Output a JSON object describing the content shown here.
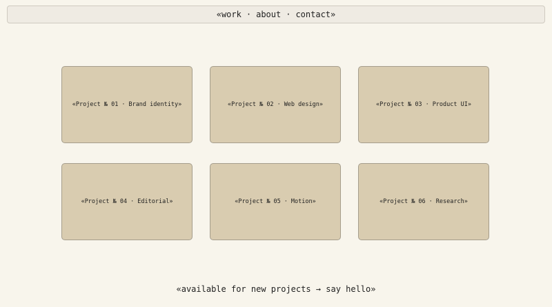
{
  "nav": {
    "open": "«",
    "items": [
      "work",
      "about",
      "contact"
    ],
    "separator": "·",
    "close": "»"
  },
  "projects": [
    {
      "number": "№ 01",
      "label": "Project",
      "title": "Brand identity"
    },
    {
      "number": "№ 02",
      "label": "Project",
      "title": "Web design"
    },
    {
      "number": "№ 03",
      "label": "Project",
      "title": "Product UI"
    },
    {
      "number": "№ 04",
      "label": "Project",
      "title": "Editorial"
    },
    {
      "number": "№ 05",
      "label": "Project",
      "title": "Motion"
    },
    {
      "number": "№ 06",
      "label": "Project",
      "title": "Research"
    }
  ],
  "footer": {
    "text": "«available for new projects → say hello»"
  },
  "colors": {
    "background": "#f8f5ec",
    "card": "#d9ccb0",
    "card_border": "#a59d8c",
    "nav_background": "#efebe3"
  }
}
